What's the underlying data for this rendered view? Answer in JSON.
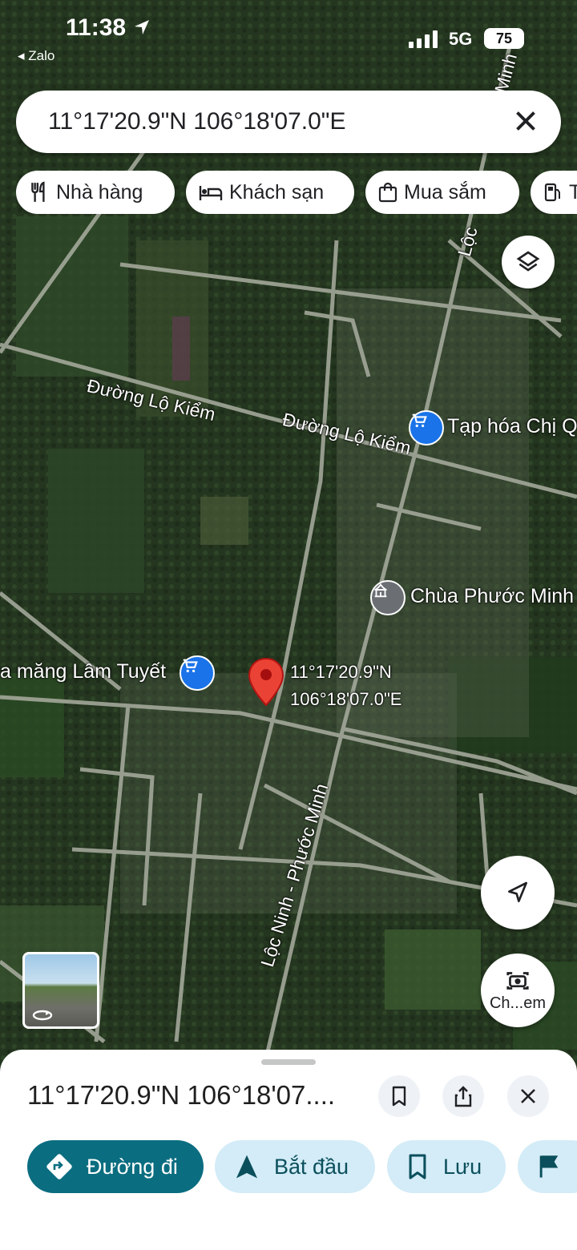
{
  "status_bar": {
    "time": "11:38",
    "back_app": "◂ Zalo",
    "network": "5G",
    "battery": "75"
  },
  "search": {
    "query": "11°17'20.9\"N 106°18'07.0\"E"
  },
  "chips": [
    {
      "label": "Nhà hàng",
      "icon": "fork-knife-icon"
    },
    {
      "label": "Khách sạn",
      "icon": "bed-icon"
    },
    {
      "label": "Mua sắm",
      "icon": "shopping-bag-icon"
    },
    {
      "label": "T",
      "icon": "gas-station-icon"
    }
  ],
  "map": {
    "road_labels": [
      {
        "text": "Đường Lộ Kiểm"
      },
      {
        "text": "Đường Lộ Kiểm"
      },
      {
        "text": "Lộc Ninh - Phước Minh"
      },
      {
        "text": "Lộc"
      },
      {
        "text": "Minh"
      }
    ],
    "places": [
      {
        "name": "Tạp hóa Chị Q",
        "icon": "shopping-cart-icon"
      },
      {
        "name": "Chùa Phước Minh",
        "icon": "temple-icon"
      },
      {
        "name": "a măng Lâm Tuyết",
        "icon": "shopping-cart-icon"
      }
    ],
    "pin_label_line1": "11°17'20.9\"N",
    "pin_label_line2": "106°18'07.0\"E",
    "camera_button_label": "Ch...em",
    "colors": {
      "pin": "#ea4335",
      "shop_poi": "#1a73e8",
      "temple_poi": "#5f6368"
    }
  },
  "sheet": {
    "title": "11°17'20.9\"N 106°18'07....",
    "actions": [
      {
        "label": "Đường đi",
        "icon": "directions-icon"
      },
      {
        "label": "Bắt đầu",
        "icon": "navigation-arrow-icon"
      },
      {
        "label": "Lưu",
        "icon": "bookmark-icon"
      }
    ]
  }
}
